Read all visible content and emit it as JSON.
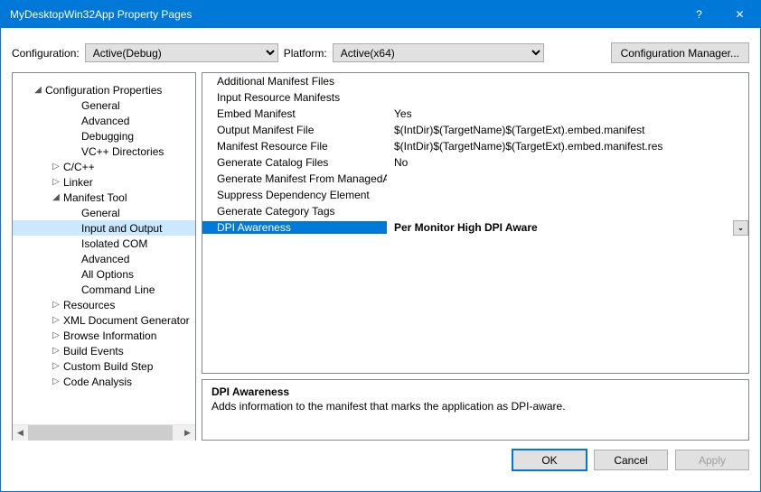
{
  "titlebar": {
    "title": "MyDesktopWin32App Property Pages",
    "help": "?",
    "close": "✕"
  },
  "config": {
    "config_label": "Configuration:",
    "config_value": "Active(Debug)",
    "platform_label": "Platform:",
    "platform_value": "Active(x64)",
    "cfg_mgr": "Configuration Manager..."
  },
  "tree": {
    "root": "Configuration Properties",
    "items": [
      {
        "label": "General",
        "indent": 3,
        "exp": ""
      },
      {
        "label": "Advanced",
        "indent": 3,
        "exp": ""
      },
      {
        "label": "Debugging",
        "indent": 3,
        "exp": ""
      },
      {
        "label": "VC++ Directories",
        "indent": 3,
        "exp": ""
      },
      {
        "label": "C/C++",
        "indent": 2,
        "exp": "▷"
      },
      {
        "label": "Linker",
        "indent": 2,
        "exp": "▷"
      },
      {
        "label": "Manifest Tool",
        "indent": 2,
        "exp": "◢"
      },
      {
        "label": "General",
        "indent": 3,
        "exp": ""
      },
      {
        "label": "Input and Output",
        "indent": 3,
        "exp": "",
        "sel": true
      },
      {
        "label": "Isolated COM",
        "indent": 3,
        "exp": ""
      },
      {
        "label": "Advanced",
        "indent": 3,
        "exp": ""
      },
      {
        "label": "All Options",
        "indent": 3,
        "exp": ""
      },
      {
        "label": "Command Line",
        "indent": 3,
        "exp": ""
      },
      {
        "label": "Resources",
        "indent": 2,
        "exp": "▷"
      },
      {
        "label": "XML Document Generator",
        "indent": 2,
        "exp": "▷"
      },
      {
        "label": "Browse Information",
        "indent": 2,
        "exp": "▷"
      },
      {
        "label": "Build Events",
        "indent": 2,
        "exp": "▷"
      },
      {
        "label": "Custom Build Step",
        "indent": 2,
        "exp": "▷"
      },
      {
        "label": "Code Analysis",
        "indent": 2,
        "exp": "▷"
      }
    ]
  },
  "grid": {
    "rows": [
      {
        "key": "Additional Manifest Files",
        "val": ""
      },
      {
        "key": "Input Resource Manifests",
        "val": ""
      },
      {
        "key": "Embed Manifest",
        "val": "Yes"
      },
      {
        "key": "Output Manifest File",
        "val": "$(IntDir)$(TargetName)$(TargetExt).embed.manifest"
      },
      {
        "key": "Manifest Resource File",
        "val": "$(IntDir)$(TargetName)$(TargetExt).embed.manifest.res"
      },
      {
        "key": "Generate Catalog Files",
        "val": "No"
      },
      {
        "key": "Generate Manifest From ManagedAssembly",
        "val": ""
      },
      {
        "key": "Suppress Dependency Element",
        "val": ""
      },
      {
        "key": "Generate Category Tags",
        "val": ""
      },
      {
        "key": "DPI Awareness",
        "val": "Per Monitor High DPI Aware",
        "sel": true
      }
    ]
  },
  "desc": {
    "title": "DPI Awareness",
    "text": "Adds information to the manifest that marks the application as DPI-aware."
  },
  "footer": {
    "ok": "OK",
    "cancel": "Cancel",
    "apply": "Apply"
  }
}
